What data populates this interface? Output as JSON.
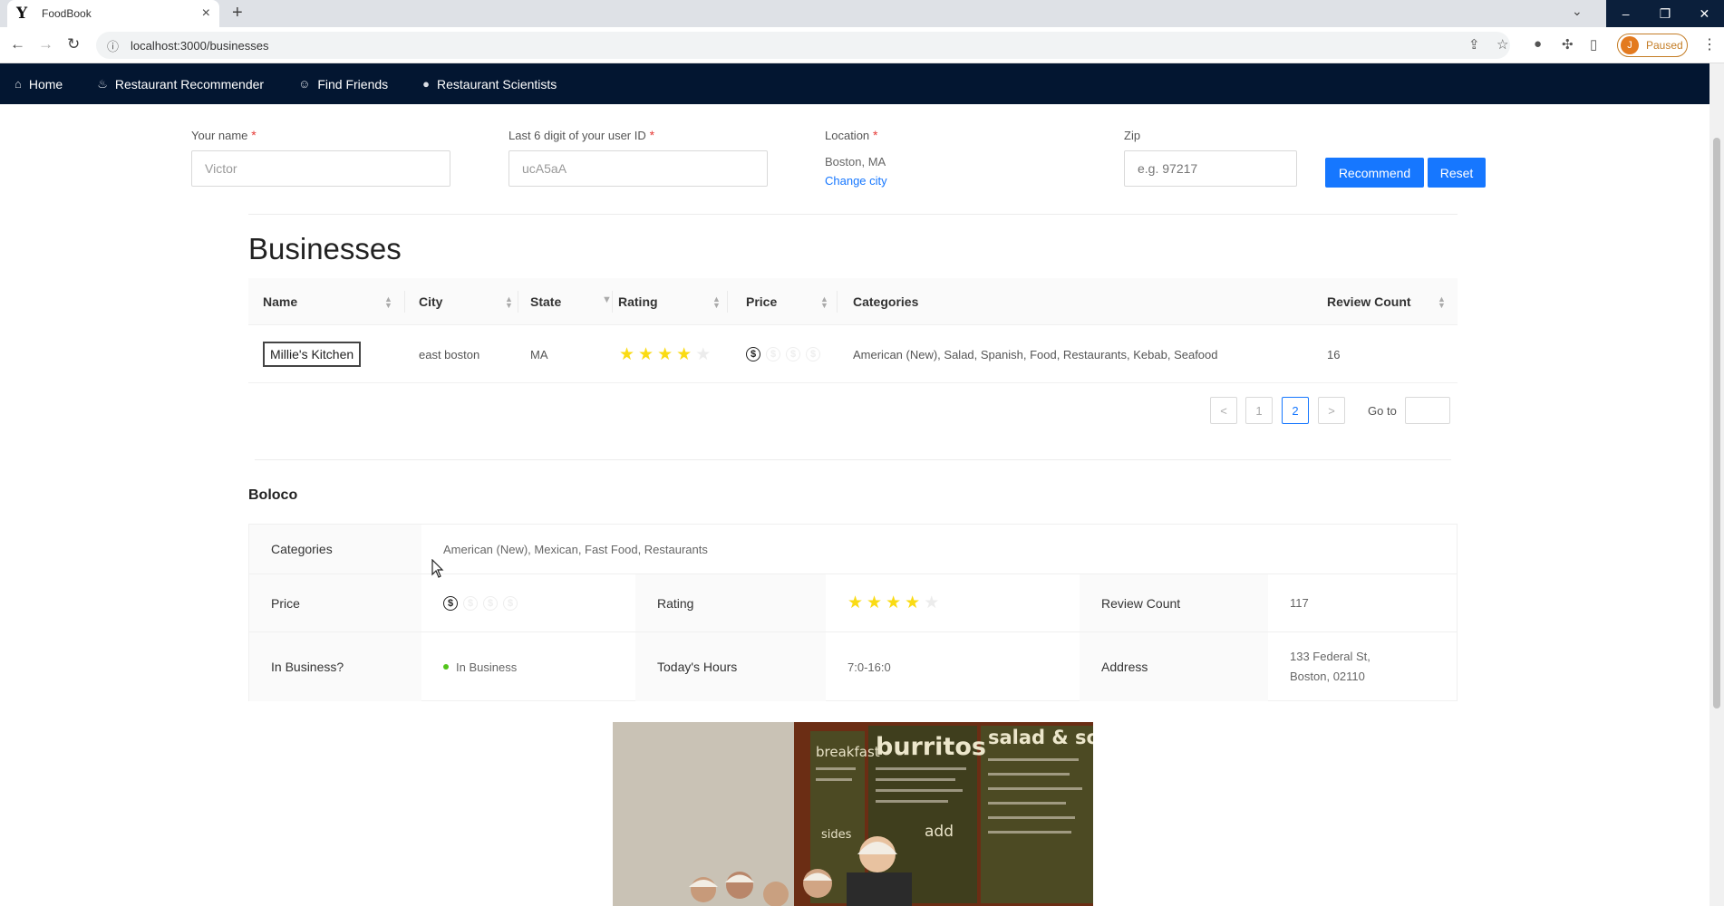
{
  "browser": {
    "tab_title": "FoodBook",
    "favicon": "Y",
    "url": "localhost:3000/businesses",
    "profile_initial": "J",
    "profile_status": "Paused"
  },
  "nav": {
    "items": [
      {
        "label": "Home",
        "icon": "home-icon"
      },
      {
        "label": "Restaurant Recommender",
        "icon": "cutlery-icon"
      },
      {
        "label": "Find Friends",
        "icon": "user-icon"
      },
      {
        "label": "Restaurant Scientists",
        "icon": "shield-icon"
      }
    ]
  },
  "form": {
    "name_label": "Your name",
    "name_value": "Victor",
    "userid_label": "Last 6 digit of your user ID",
    "userid_value": "ucA5aA",
    "location_label": "Location",
    "location_value": "Boston, MA",
    "change_city": "Change city",
    "zip_label": "Zip",
    "zip_placeholder": "e.g. 97217",
    "required_mark": "*",
    "recommend_button": "Recommend",
    "reset_button": "Reset"
  },
  "businesses": {
    "title": "Businesses",
    "columns": [
      "Name",
      "City",
      "State",
      "Rating",
      "Price",
      "Categories",
      "Review Count"
    ],
    "rows": [
      {
        "name": "Millie's Kitchen",
        "city": "east boston",
        "state": "MA",
        "rating": 4,
        "price": 1,
        "categories": "American (New), Salad, Spanish, Food, Restaurants, Kebab, Seafood",
        "review_count": "16"
      }
    ],
    "pagination": {
      "pages": [
        "1",
        "2"
      ],
      "current": "2",
      "goto_label": "Go to",
      "prev": "<",
      "next": ">"
    }
  },
  "detail": {
    "name": "Boloco",
    "categories_label": "Categories",
    "categories": "American (New), Mexican, Fast Food, Restaurants",
    "price_label": "Price",
    "price": 1,
    "rating_label": "Rating",
    "rating": 4,
    "review_count_label": "Review Count",
    "review_count": "117",
    "in_business_label": "In Business?",
    "in_business": "In Business",
    "hours_label": "Today's Hours",
    "hours": "7:0-16:0",
    "address_label": "Address",
    "address_line1": "133 Federal St,",
    "address_line2": "Boston, 02110",
    "photo_signs": {
      "breakfast": "breakfast",
      "burritos": "burritos",
      "salad": "salad & soup",
      "sides": "sides",
      "add": "add"
    }
  },
  "colors": {
    "nav_bg": "#031631",
    "primary": "#1677ff",
    "star": "#fadb14",
    "success": "#52c41a"
  }
}
